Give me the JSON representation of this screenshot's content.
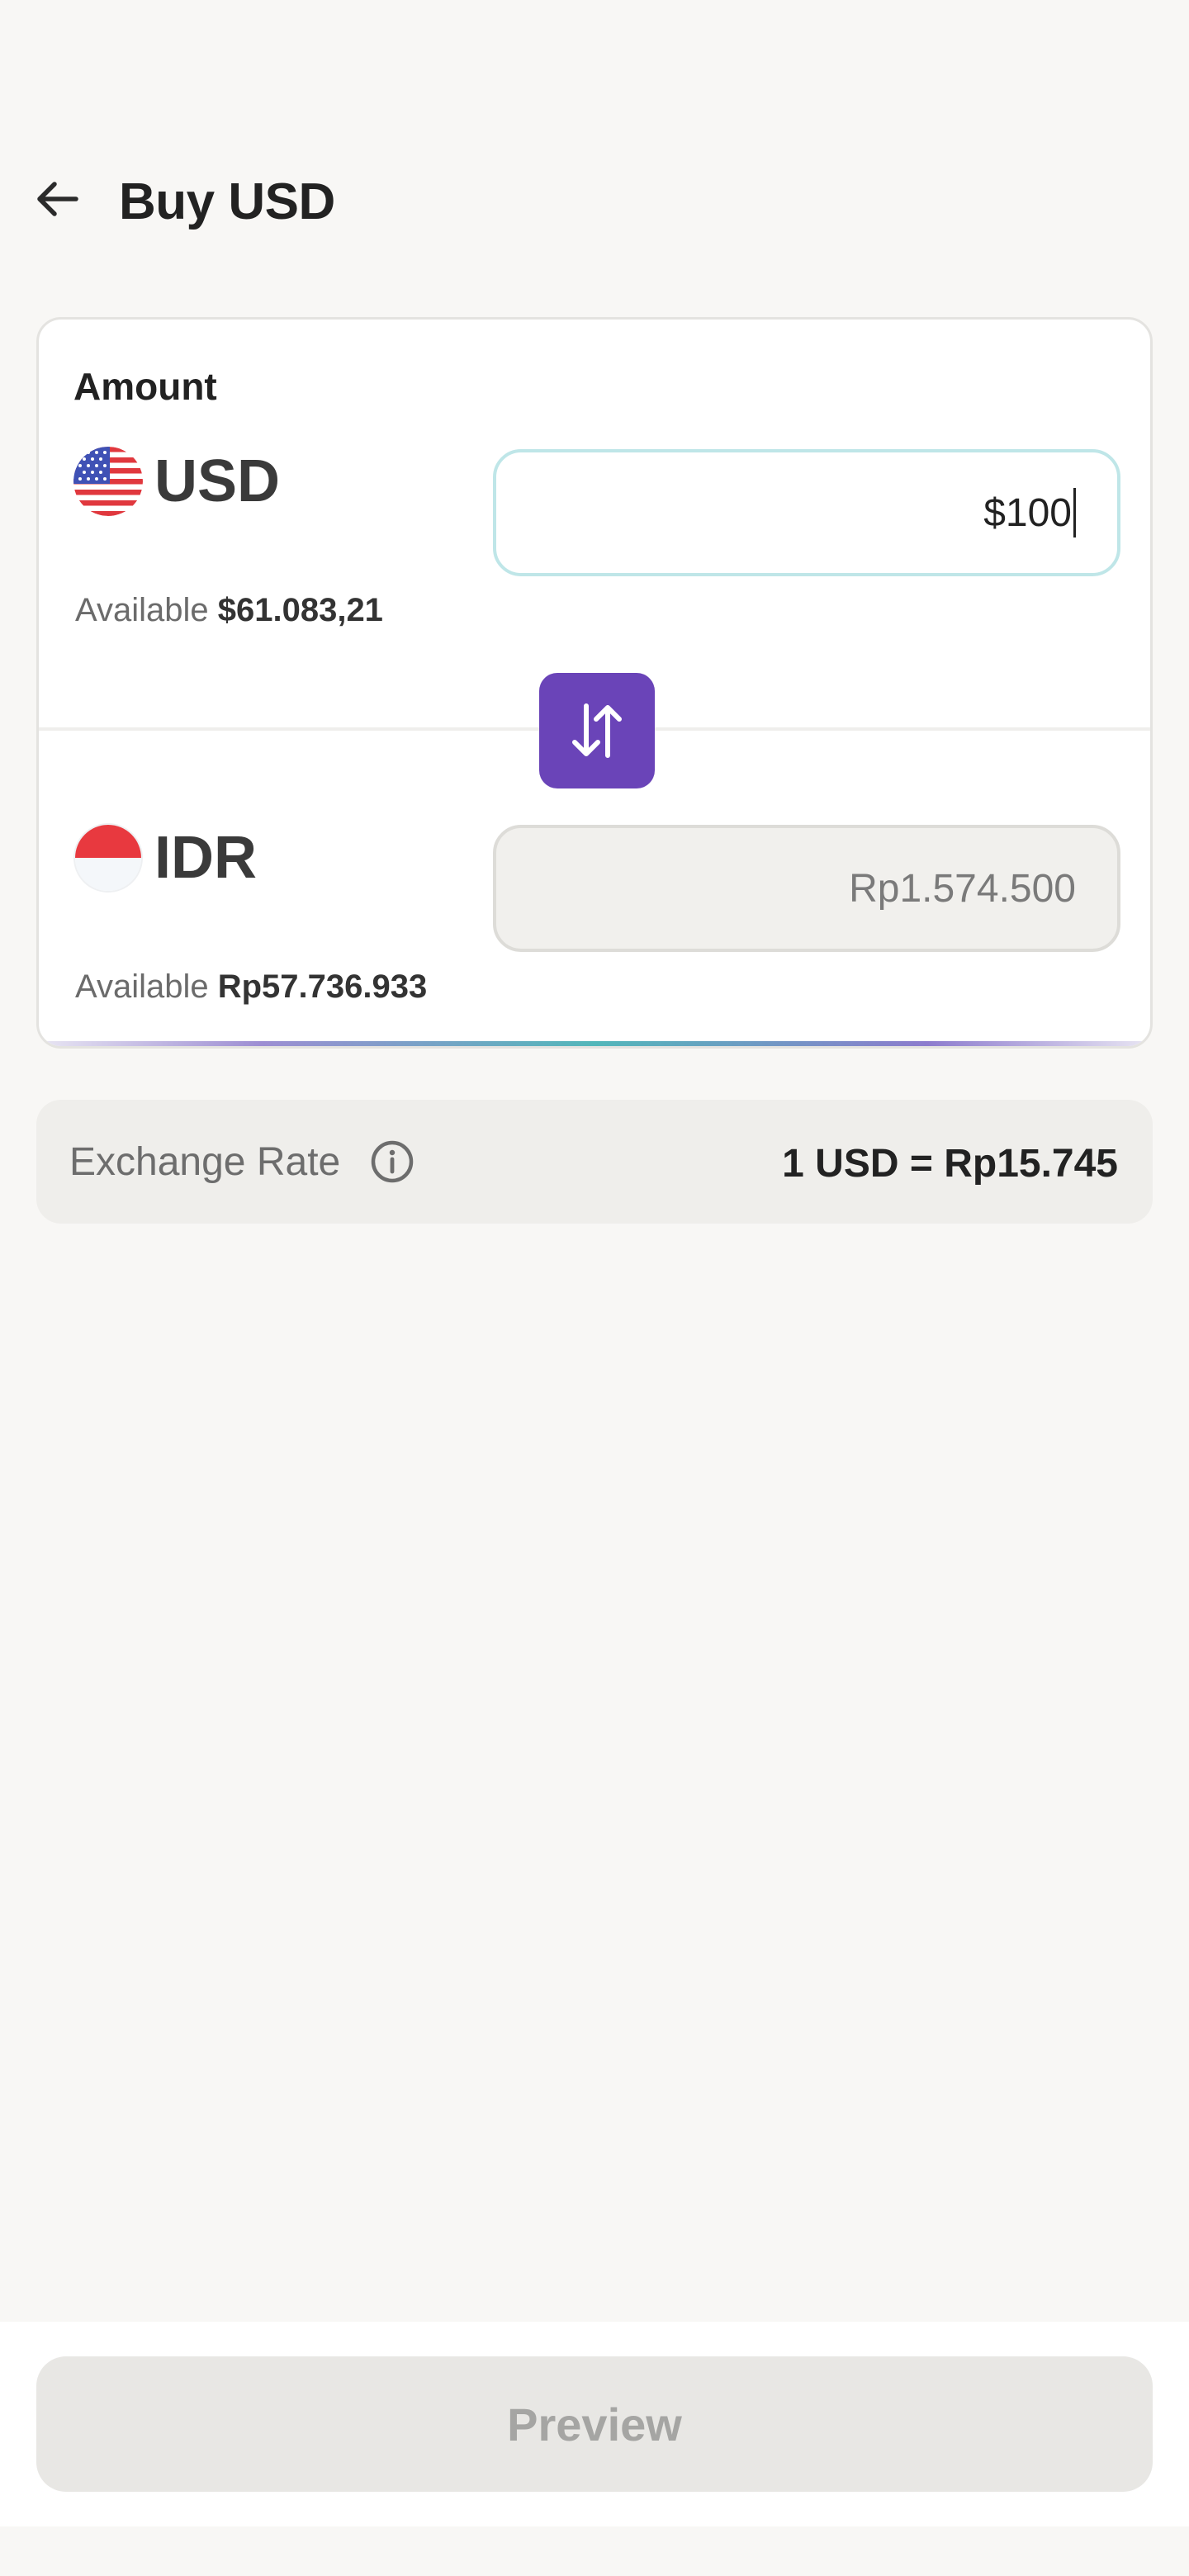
{
  "header": {
    "title": "Buy USD"
  },
  "amount_card": {
    "label": "Amount",
    "from": {
      "currency": "USD",
      "flag": "us-flag",
      "available_label": "Available",
      "available_value": "$61.083,21",
      "input_value": "$100"
    },
    "to": {
      "currency": "IDR",
      "flag": "indonesia-flag",
      "available_label": "Available",
      "available_value": "Rp57.736.933",
      "input_value": "Rp1.574.500"
    },
    "swap_icon": "swap-vertical-icon"
  },
  "exchange_rate": {
    "label": "Exchange Rate",
    "value": "1 USD = Rp15.745",
    "icon": "info-icon"
  },
  "footer": {
    "preview_label": "Preview"
  },
  "colors": {
    "accent_purple": "#6a44b8",
    "input_active_border": "#bfe6e8",
    "background": "#f8f7f5",
    "disabled_button": "#e8e7e4"
  }
}
